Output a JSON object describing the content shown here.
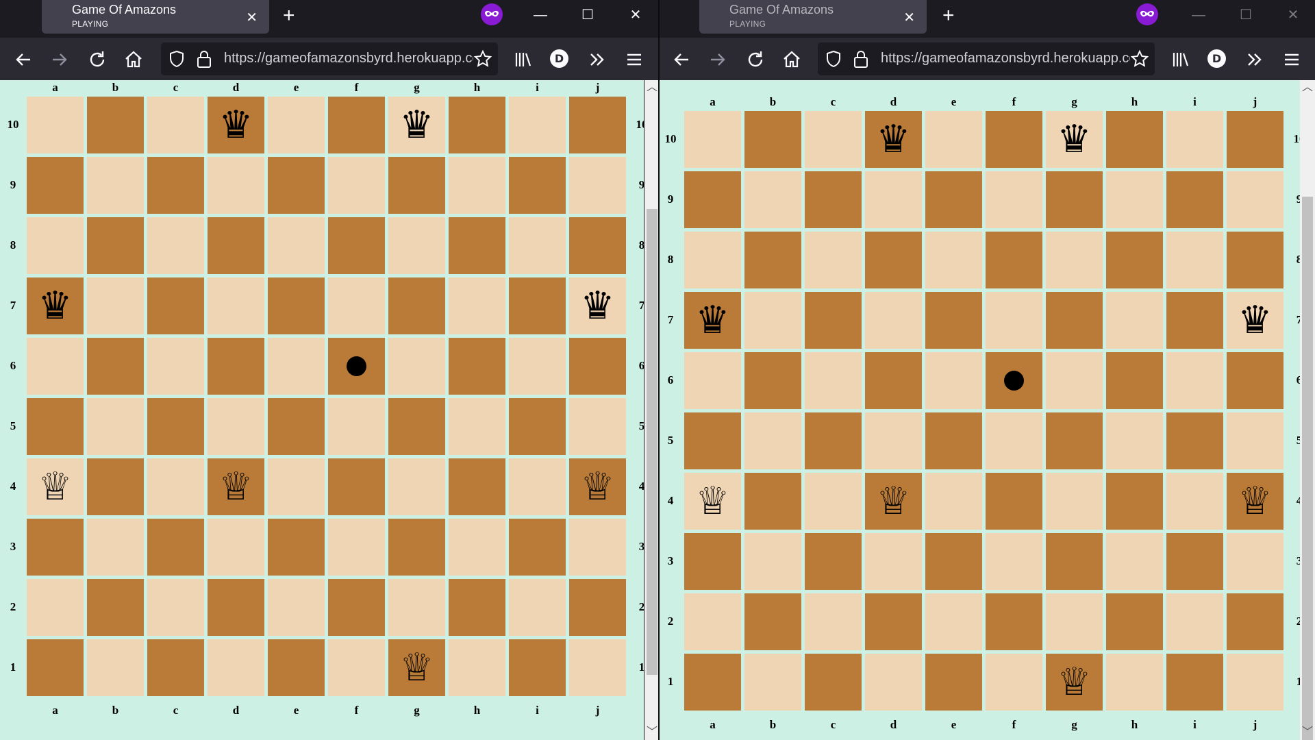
{
  "browser": {
    "tab_title": "Game Of Amazons",
    "tab_subtitle": "PLAYING",
    "url": "https://gameofamazonsbyrd.herokuapp.com",
    "avatar_letter": "D"
  },
  "board": {
    "files": [
      "a",
      "b",
      "c",
      "d",
      "e",
      "f",
      "g",
      "h",
      "i",
      "j"
    ],
    "ranks": [
      "10",
      "9",
      "8",
      "7",
      "6",
      "5",
      "4",
      "3",
      "2",
      "1"
    ],
    "black_queens": [
      "d10",
      "g10",
      "a7",
      "j7"
    ],
    "white_queens": [
      "a4",
      "d4",
      "j4",
      "g1"
    ],
    "arrows": [
      "f6"
    ],
    "colors": {
      "light": "#f0d5b4",
      "dark": "#b97b37",
      "background": "#cdf0e4"
    }
  },
  "glyphs": {
    "black_queen": "♛",
    "white_queen": "♕"
  },
  "icons": [
    "back-icon",
    "forward-icon",
    "reload-icon",
    "home-icon",
    "shield-icon",
    "lock-icon",
    "star-icon",
    "library-icon",
    "overflow-icon",
    "menu-icon",
    "private-browsing-icon",
    "minimize-icon",
    "maximize-icon",
    "close-icon",
    "new-tab-icon"
  ]
}
